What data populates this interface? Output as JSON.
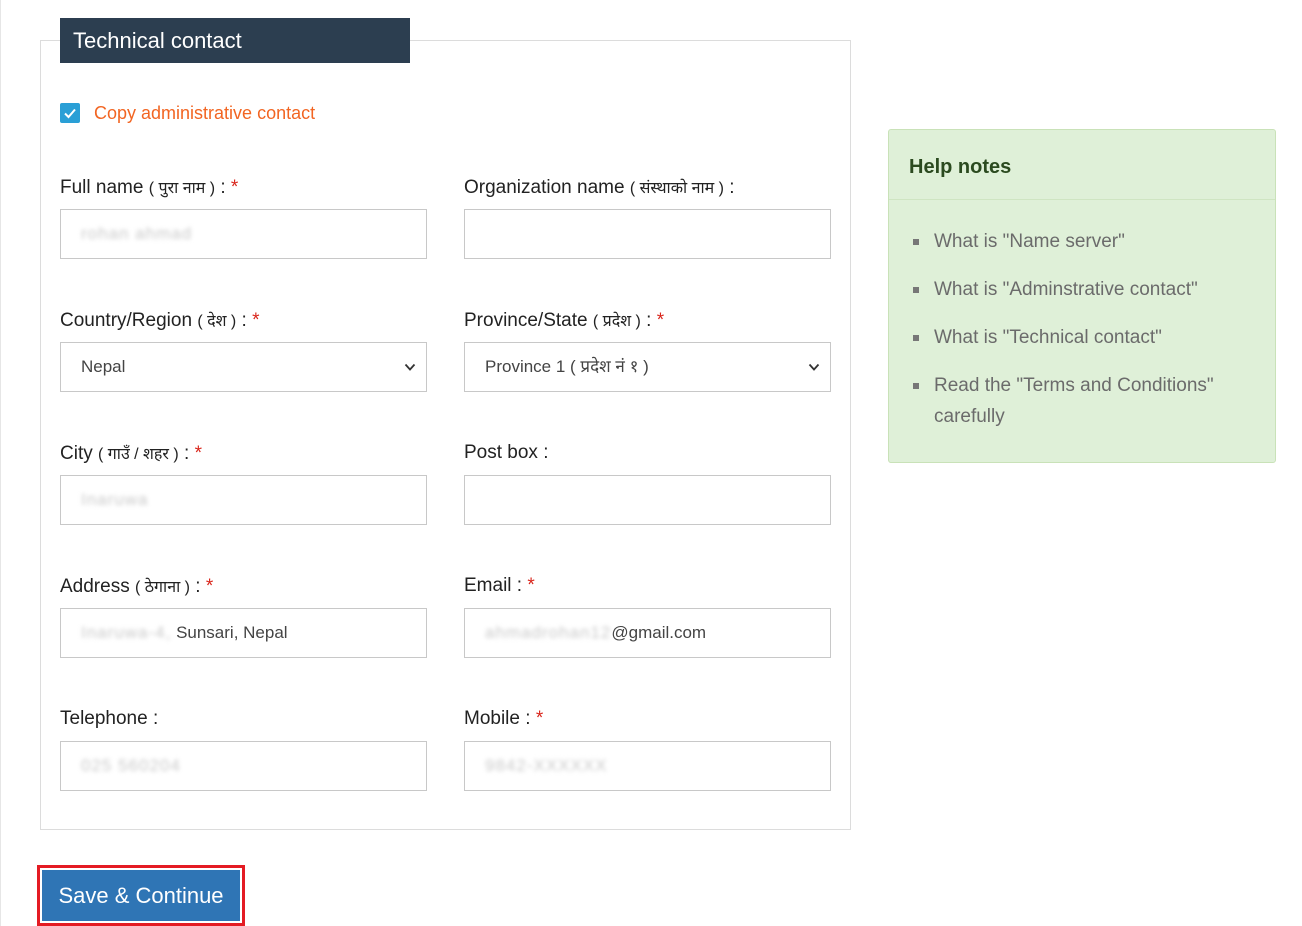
{
  "section": {
    "title": "Technical contact"
  },
  "copy_admin": {
    "label": "Copy administrative contact",
    "checked": true
  },
  "fields": {
    "full_name": {
      "label": "Full name",
      "np": "( पुरा नाम )",
      "suffix": " : ",
      "required": "*",
      "value_masked": "rohan ahmad"
    },
    "organization": {
      "label": "Organization name",
      "np": "( संस्थाको नाम )",
      "suffix": " : ",
      "value": ""
    },
    "country": {
      "label": "Country/Region",
      "np": "( देश )",
      "suffix": " : ",
      "required": "*",
      "value": "Nepal"
    },
    "province": {
      "label": "Province/State",
      "np": "( प्रदेश )",
      "suffix": " : ",
      "required": "*",
      "value": "Province 1 ( प्रदेश नं १ )"
    },
    "city": {
      "label": "City",
      "np": "( गाउँ / शहर )",
      "suffix": " : ",
      "required": "*",
      "value_masked": "Inaruwa"
    },
    "post_box": {
      "label": "Post box :",
      "value": ""
    },
    "address": {
      "label": "Address",
      "np": "( ठेगाना )",
      "suffix": " : ",
      "required": "*",
      "value_masked": "Inaruwa-4,",
      "value_visible": "Sunsari, Nepal"
    },
    "email": {
      "label": "Email : ",
      "required": "*",
      "value_masked": "ahmadrohan12",
      "value_visible": "@gmail.com"
    },
    "telephone": {
      "label": "Telephone :",
      "value_masked": "025 560204"
    },
    "mobile": {
      "label": "Mobile : ",
      "required": "*",
      "value_masked": "9842-XXXXXX"
    }
  },
  "save_button": {
    "label": "Save & Continue"
  },
  "help_notes": {
    "title": "Help notes",
    "items": [
      "What is \"Name server\"",
      "What is \"Adminstrative contact\"",
      "What is \"Technical contact\"",
      "Read the \"Terms and Conditions\" carefully"
    ]
  },
  "colors": {
    "header_bg": "#2c3e50",
    "accent_orange": "#f26522",
    "required_red": "#d9261c",
    "button_blue": "#2f75b5",
    "help_bg": "#dff0d8",
    "highlight_red": "#e41b23"
  }
}
